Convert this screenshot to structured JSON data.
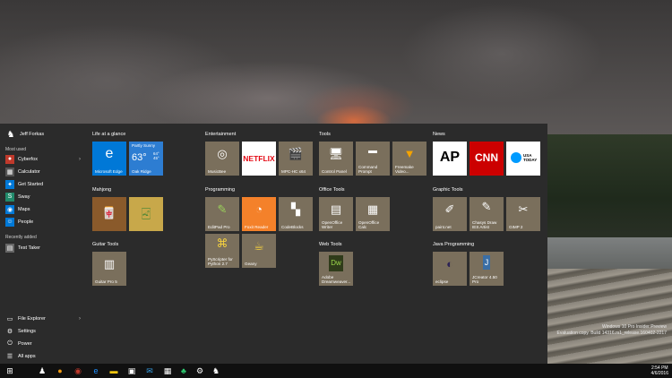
{
  "colors": {
    "tile": "#7a6f5c",
    "edge": "#0078d7",
    "weather": "#2d7dd2",
    "cnn": "#cc0000",
    "reader": "#f4812a",
    "ap_bg": "#ffffff"
  },
  "user": {
    "name": "Jeff Forkas"
  },
  "rail": {
    "most_used_heading": "Most used",
    "most_used": [
      {
        "label": "Cyberfox",
        "icon": "cyberfox-icon",
        "has_submenu": true
      },
      {
        "label": "Calculator",
        "icon": "calculator-icon"
      },
      {
        "label": "Get Started",
        "icon": "lightbulb-icon"
      },
      {
        "label": "Sway",
        "icon": "sway-icon"
      },
      {
        "label": "Maps",
        "icon": "maps-icon"
      },
      {
        "label": "People",
        "icon": "people-icon"
      }
    ],
    "recent_heading": "Recently added",
    "recent": [
      {
        "label": "Test Taker",
        "icon": "test-taker-icon"
      }
    ],
    "bottom": [
      {
        "label": "File Explorer",
        "icon": "folder-icon",
        "has_submenu": true
      },
      {
        "label": "Settings",
        "icon": "gear-icon"
      },
      {
        "label": "Power",
        "icon": "power-icon"
      },
      {
        "label": "All apps",
        "icon": "list-icon"
      }
    ]
  },
  "groups": {
    "life": "Life at a glance",
    "mahjong": "Mahjong",
    "guitar": "Guitar Tools",
    "entertainment": "Entertainment",
    "programming": "Programming",
    "tools": "Tools",
    "office": "Office Tools",
    "web": "Web Tools",
    "news": "News",
    "graphic": "Graphic Tools",
    "java": "Java Programming"
  },
  "tiles": {
    "edge": "Microsoft Edge",
    "weather": {
      "city": "Partly Sunny",
      "temp": "63°",
      "hi": "64°",
      "lo": "45°",
      "place": "Oak Ridge"
    },
    "musicbee": "MusicBee",
    "netflix": "NETFLIX",
    "mpc": "MPC-HC x64",
    "editpad": "EditPad Pro",
    "foxit": "Foxit Reader",
    "codeblocks": "CodeBlocks",
    "pyscripter": "PyScripter for Python 2.7",
    "geany": "Geany",
    "control_panel": "Control Panel",
    "command_prompt": "Command Prompt",
    "freemake": "Freemake Video...",
    "oo_writer": "OpenOffice Writer",
    "oo_calc": "OpenOffice Calc",
    "dreamweaver": "Adobe Dreamweaver...",
    "ap": "AP",
    "cnn": "CNN",
    "usatoday": "USA TODAY",
    "paintnet": "paint.net",
    "chasys": "Chasys Draw IES Artist",
    "gimp": "GIMP 2",
    "guitarpro": "Guitar Pro 5",
    "eclipse": "eclipse",
    "jcreator": "JCreator 4.50 Pro"
  },
  "watermark": {
    "line1": "Windows 10 Pro Insider Preview",
    "line2": "Evaluation copy. Build 14316.rs1_release.160402-2217"
  },
  "tray": {
    "time": "2:54 PM",
    "date": "4/6/2016"
  }
}
